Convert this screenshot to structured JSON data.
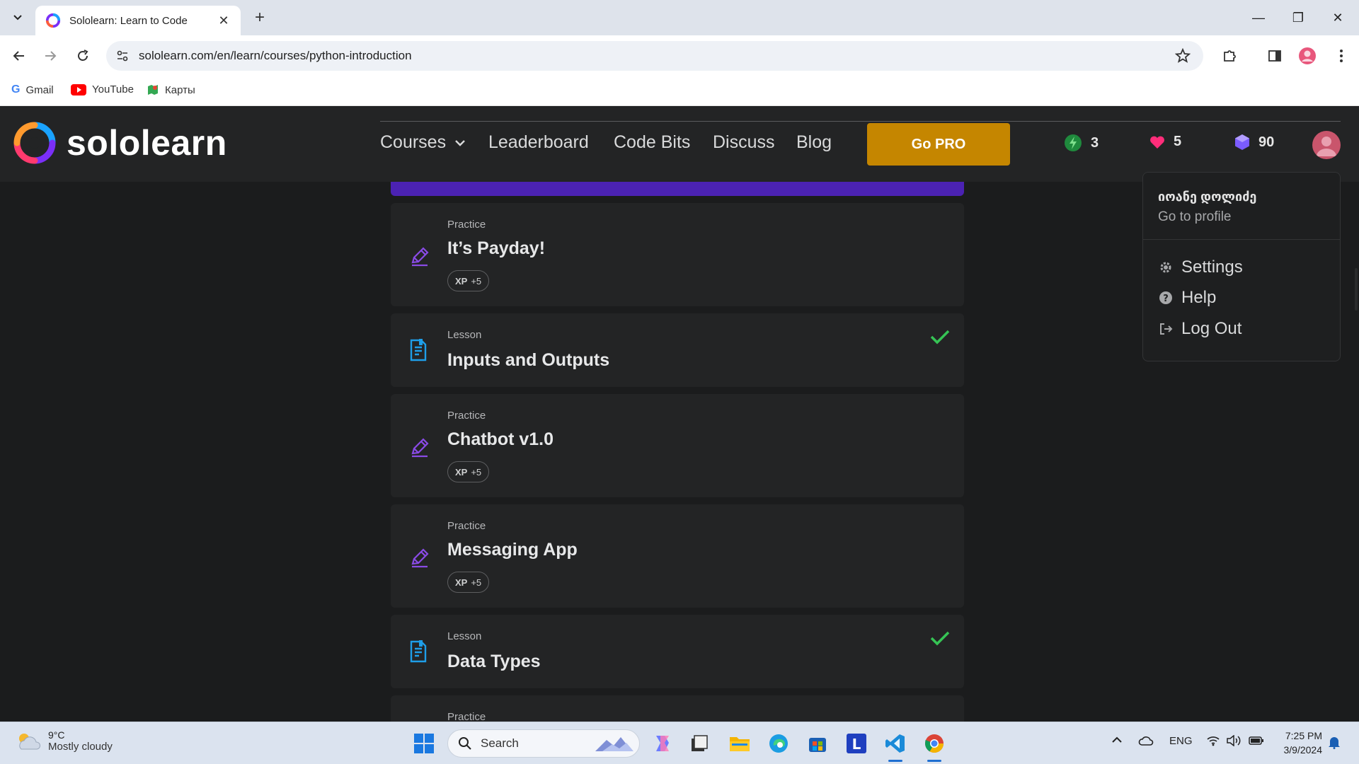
{
  "browser": {
    "tab_title": "Sololearn: Learn to Code",
    "url": "sololearn.com/en/learn/courses/python-introduction",
    "bookmarks": [
      {
        "label": "Gmail",
        "icon": "google-icon"
      },
      {
        "label": "YouTube",
        "icon": "youtube-icon"
      },
      {
        "label": "Карты",
        "icon": "maps-icon"
      }
    ]
  },
  "site": {
    "logo_text": "sololearn",
    "nav": {
      "courses": "Courses",
      "leaderboard": "Leaderboard",
      "code_bits": "Code Bits",
      "discuss": "Discuss",
      "blog": "Blog",
      "go_pro": "Go PRO"
    },
    "stats": {
      "streak": "3",
      "hearts": "5",
      "gems": "90"
    },
    "colors": {
      "accent_purple": "#4b22b3",
      "pro_gold": "#c58600",
      "practice_icon": "#8a4be6",
      "lesson_icon": "#1e9ee8",
      "check_green": "#36c455"
    }
  },
  "items": [
    {
      "kind": "Practice",
      "title": "It’s Payday!",
      "xp": "+5",
      "completed": false
    },
    {
      "kind": "Lesson",
      "title": "Inputs and Outputs",
      "completed": true
    },
    {
      "kind": "Practice",
      "title": "Chatbot v1.0",
      "xp": "+5",
      "completed": false
    },
    {
      "kind": "Practice",
      "title": "Messaging App",
      "xp": "+5",
      "completed": false
    },
    {
      "kind": "Lesson",
      "title": "Data Types",
      "completed": true
    },
    {
      "kind": "Practice"
    }
  ],
  "xp_label": "XP",
  "profile_menu": {
    "username": "იოანე დოლიძე",
    "go_to_profile": "Go to profile",
    "settings": "Settings",
    "help": "Help",
    "log_out": "Log Out"
  },
  "taskbar": {
    "temperature": "9°C",
    "weather": "Mostly cloudy",
    "search_placeholder": "Search",
    "language": "ENG",
    "time": "7:25 PM",
    "date": "3/9/2024"
  }
}
